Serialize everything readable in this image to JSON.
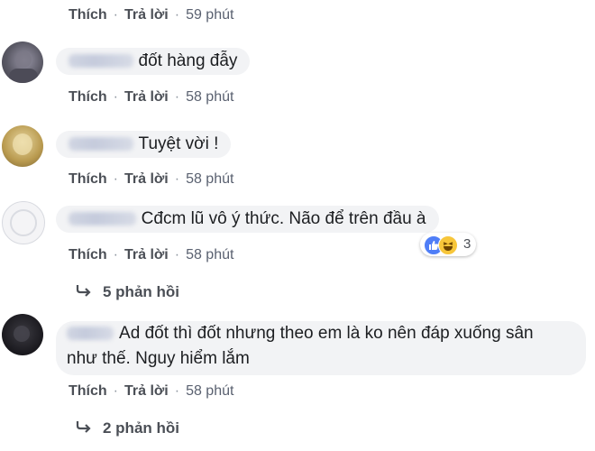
{
  "comments": [
    {
      "text": "",
      "actions": {
        "like": "Thích",
        "reply": "Trả lời",
        "time": "59 phút"
      }
    },
    {
      "text": "đốt hàng đẫy",
      "actions": {
        "like": "Thích",
        "reply": "Trả lời",
        "time": "58 phút"
      }
    },
    {
      "text": "Tuyệt vời !",
      "actions": {
        "like": "Thích",
        "reply": "Trả lời",
        "time": "58 phút"
      }
    },
    {
      "text": "Cđcm lũ vô ý thức. Não để trên đầu à",
      "actions": {
        "like": "Thích",
        "reply": "Trả lời",
        "time": "58 phút"
      },
      "reactions": {
        "icons": [
          "like-icon",
          "haha-icon"
        ],
        "count": "3"
      },
      "replies_label": "5 phản hồi"
    },
    {
      "text_line1": "Ad đốt thì đốt nhưng theo em là ko nên đáp xuống sân",
      "text_line2": "như thế. Nguy hiểm lắm",
      "actions": {
        "like": "Thích",
        "reply": "Trả lời",
        "time": "58 phút"
      },
      "replies_label": "2 phản hồi"
    }
  ],
  "separator": "·",
  "reply_arrow_icon": "reply-arrow-icon",
  "colors": {
    "bubble": "#f2f3f5",
    "action_text": "#4b4f56",
    "like_blue": "#4f7ef7",
    "haha_yellow": "#f7c63a"
  }
}
